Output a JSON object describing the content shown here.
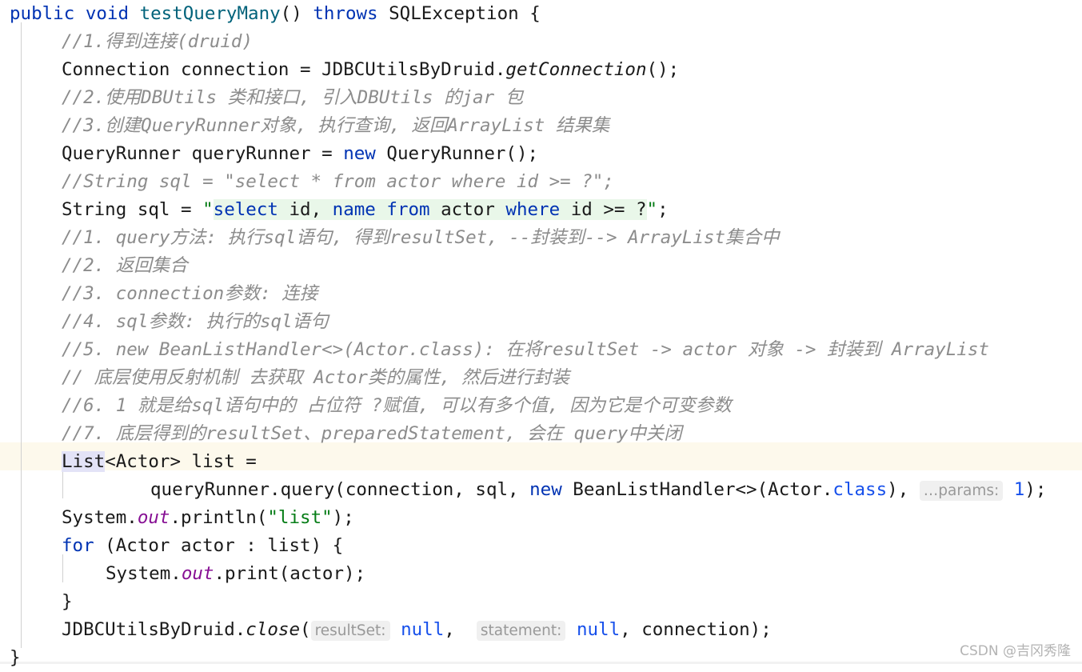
{
  "editor": {
    "language": "java",
    "theme": "light",
    "colors": {
      "background": "#ffffff",
      "foreground": "#1a1a1a",
      "keyword": "#0033b3",
      "comment": "#8c8c8c",
      "string": "#067d17",
      "number": "#1750eb",
      "static_field": "#871094",
      "method_declaration": "#00627a",
      "sql_injection_background": "#e9f7e9",
      "caret_line_background": "#fdf9ec",
      "selection_background": "#e3e3f7",
      "hint_background": "#f0f0f0",
      "hint_foreground": "#999999",
      "indent_guide": "#d0d0d0"
    }
  },
  "watermark": {
    "text": "CSDN @吉冈秀隆"
  },
  "code": {
    "line01": {
      "kw_public": "public",
      "kw_void": "void",
      "method_name": "testQueryMany",
      "parens": "()",
      "kw_throws": "throws",
      "type_exception": "SQLException",
      "brace": "{"
    },
    "line02": {
      "comment": "//1.得到连接(druid)"
    },
    "line03": {
      "type": "Connection",
      "var": "connection",
      "eq": "=",
      "class": "JDBCUtilsByDruid",
      "dot": ".",
      "call": "getConnection",
      "tail": "();"
    },
    "line04": {
      "comment": "//2.使用DBUtils 类和接口, 引入DBUtils 的jar 包"
    },
    "line05": {
      "comment": "//3.创建QueryRunner对象, 执行查询, 返回ArrayList 结果集"
    },
    "line06": {
      "type": "QueryRunner",
      "var": "queryRunner",
      "eq": "=",
      "kw_new": "new",
      "ctor": "QueryRunner();"
    },
    "line07": {
      "comment": "//String sql = \"select * from actor where id >= ?\";"
    },
    "line08": {
      "type": "String",
      "var": "sql",
      "eq": "=",
      "quote_open": "\"",
      "sql_select": "select",
      "sql_cols": " id, ",
      "sql_name": "name",
      "sql_space1": " ",
      "sql_from": "from",
      "sql_table": " actor ",
      "sql_where": "where",
      "sql_cond": " id >= ?",
      "quote_close": "\"",
      "semicolon": ";"
    },
    "line09": {
      "comment": "//1. query方法: 执行sql语句, 得到resultSet, --封装到--> ArrayList集合中"
    },
    "line10": {
      "comment": "//2. 返回集合"
    },
    "line11": {
      "comment": "//3. connection参数: 连接"
    },
    "line12": {
      "comment": "//4. sql参数: 执行的sql语句"
    },
    "line13": {
      "comment": "//5. new BeanListHandler<>(Actor.class): 在将resultSet -> actor 对象 -> 封装到 ArrayList"
    },
    "line14": {
      "comment": "// 底层使用反射机制 去获取 Actor类的属性, 然后进行封装"
    },
    "line15": {
      "comment": "//6. 1 就是给sql语句中的 占位符 ?赋值, 可以有多个值, 因为它是个可变参数"
    },
    "line16": {
      "comment": "//7. 底层得到的resultSet、preparedStatement, 会在 query中关闭"
    },
    "line17": {
      "selected_type": "List",
      "generic": "<Actor>",
      "var": " list =",
      "is_caret_line": true,
      "is_selected": true
    },
    "line18": {
      "receiver": "queryRunner",
      "dot": ".",
      "call": "query(connection, sql, ",
      "kw_new": "new",
      "handler": " BeanListHandler<>(Actor.",
      "kw_class": "class",
      "after_class": "), ",
      "hint_label": "…params:",
      "arg_value": "1",
      "tail": ");"
    },
    "line19": {
      "sys": "System.",
      "out": "out",
      "print": ".println(",
      "str": "\"list\"",
      "tail": ");"
    },
    "line20": {
      "kw_for": "for",
      "rest": " (Actor actor : list) {"
    },
    "line21": {
      "sys": "System.",
      "out": "out",
      "print": ".print(actor);"
    },
    "line22": {
      "brace": "}"
    },
    "line23": {
      "class": "JDBCUtilsByDruid",
      "dot": ".",
      "call": "close",
      "paren_open": "(",
      "hint_resultset": "resultSet:",
      "null1": "null",
      "comma1": ", ",
      "hint_statement": "statement:",
      "null2": "null",
      "rest": ", connection);"
    },
    "line24": {
      "brace": "}"
    }
  }
}
